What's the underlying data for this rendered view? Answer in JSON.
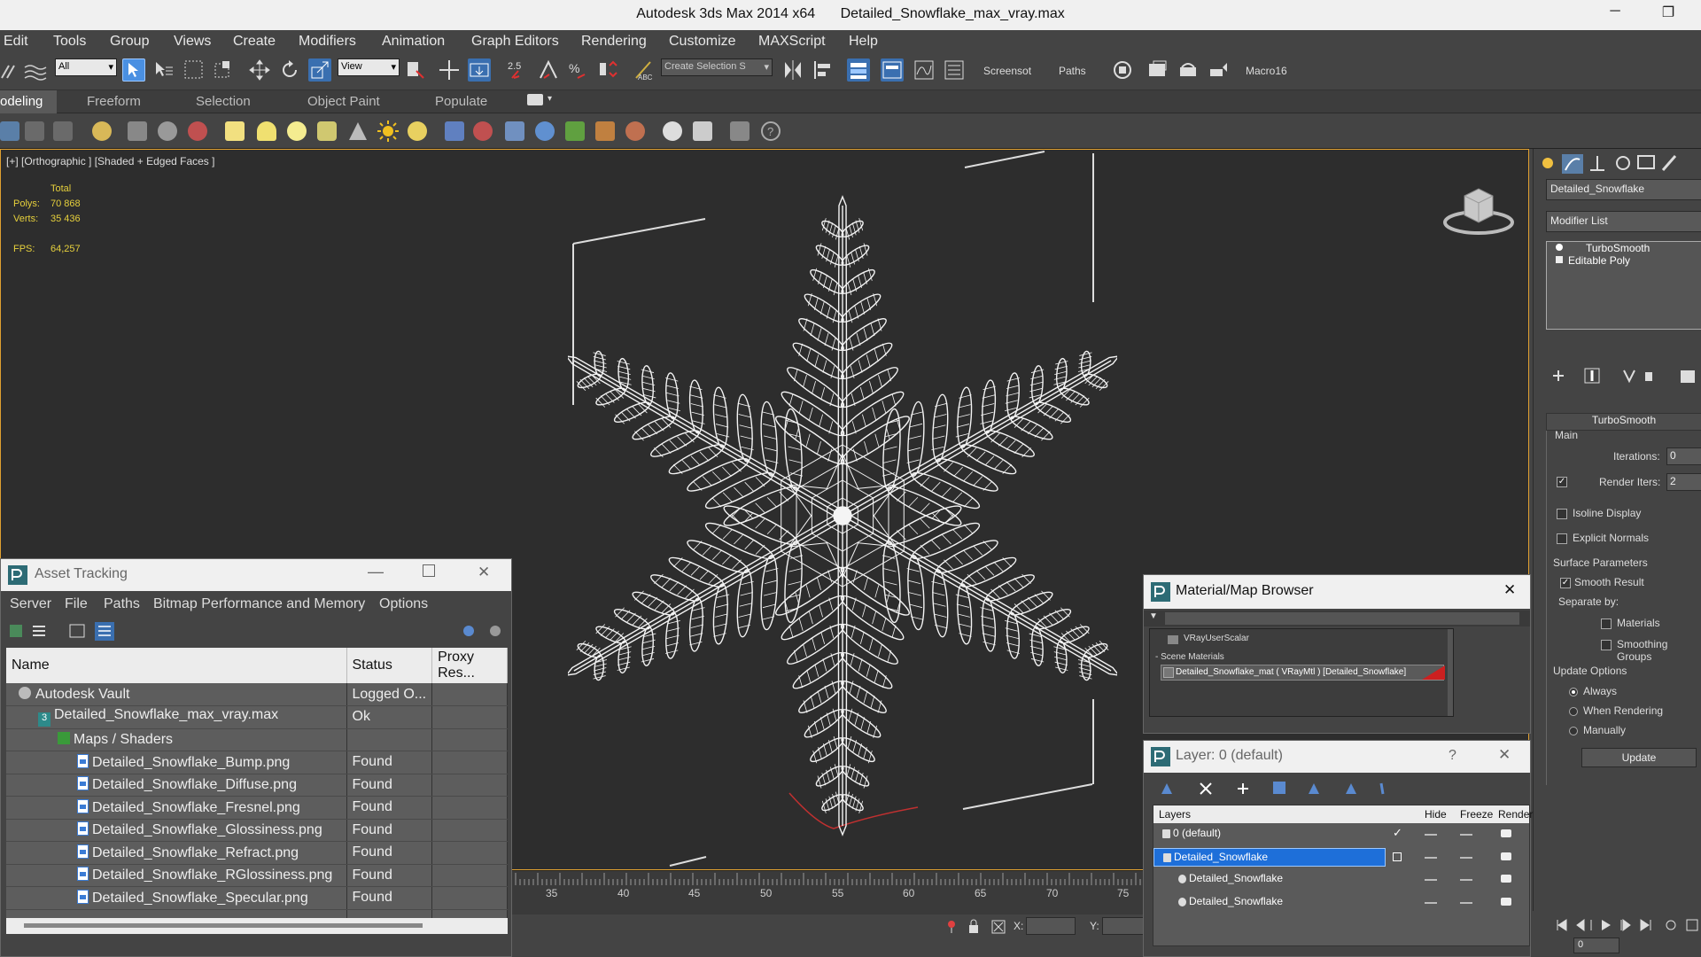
{
  "window": {
    "app_title": "Autodesk 3ds Max  2014 x64",
    "file_name": "Detailed_Snowflake_max_vray.max",
    "minimize": "─",
    "restore": "❐"
  },
  "menu": [
    "Edit",
    "Tools",
    "Group",
    "Views",
    "Create",
    "Modifiers",
    "Animation",
    "Graph Editors",
    "Rendering",
    "Customize",
    "MAXScript",
    "Help"
  ],
  "toolbar": {
    "filter_select": "All",
    "ref_coord_select": "View",
    "selection_set_placeholder": "Create Selection S",
    "snap_value": "2.5",
    "screenshot_label": "Screensot",
    "paths_label": "Paths",
    "macro_label": "Macro16"
  },
  "ribbon": {
    "tabs": [
      "odeling",
      "Freeform",
      "Selection",
      "Object Paint",
      "Populate"
    ]
  },
  "viewport": {
    "label": "[+] [Orthographic ] [Shaded + Edged Faces ]",
    "stats_total": "Total",
    "polys_label": "Polys:",
    "polys_value": "70 868",
    "verts_label": "Verts:",
    "verts_value": "35 436",
    "fps_label": "FPS:",
    "fps_value": "64,257"
  },
  "command_panel": {
    "object_name": "Detailed_Snowflake",
    "modifier_list": "Modifier List",
    "stack": [
      "TurboSmooth",
      "Editable Poly"
    ],
    "rollout_title": "TurboSmooth",
    "main_label": "Main",
    "iterations_label": "Iterations:",
    "iterations_value": "0",
    "render_iters_label": "Render Iters:",
    "render_iters_value": "2",
    "render_iters_checked": "✓",
    "isoline": "Isoline Display",
    "explicit_normals": "Explicit Normals",
    "surface_params": "Surface Parameters",
    "smooth_result": "Smooth Result",
    "smooth_result_checked": "✓",
    "separate_by": "Separate by:",
    "materials": "Materials",
    "smoothing_groups": "Smoothing Groups",
    "update_options": "Update Options",
    "always": "Always",
    "when_rendering": "When Rendering",
    "manually": "Manually",
    "update_button": "Update"
  },
  "timeline": {
    "ticks": [
      "35",
      "40",
      "45",
      "50",
      "55",
      "60",
      "65",
      "70",
      "75"
    ],
    "x_label": "X:",
    "y_label": "Y:",
    "frame_value": "0"
  },
  "asset_tracking": {
    "title": "Asset Tracking",
    "close": "✕",
    "menu": [
      "Server",
      "File",
      "Paths",
      "Bitmap Performance and Memory",
      "Options"
    ],
    "columns": [
      "Name",
      "Status",
      "Proxy Res..."
    ],
    "rows": [
      {
        "name": "Autodesk Vault",
        "status": "Logged O...",
        "indent": 0,
        "icon": "vault-icon"
      },
      {
        "name": "Detailed_Snowflake_max_vray.max",
        "status": "Ok",
        "indent": 1,
        "icon": "max-file-icon"
      },
      {
        "name": "Maps / Shaders",
        "status": "",
        "indent": 2,
        "icon": "maps-folder-icon"
      },
      {
        "name": "Detailed_Snowflake_Bump.png",
        "status": "Found",
        "indent": 3,
        "icon": "image-file-icon"
      },
      {
        "name": "Detailed_Snowflake_Diffuse.png",
        "status": "Found",
        "indent": 3,
        "icon": "image-file-icon"
      },
      {
        "name": "Detailed_Snowflake_Fresnel.png",
        "status": "Found",
        "indent": 3,
        "icon": "image-file-icon"
      },
      {
        "name": "Detailed_Snowflake_Glossiness.png",
        "status": "Found",
        "indent": 3,
        "icon": "image-file-icon"
      },
      {
        "name": "Detailed_Snowflake_Refract.png",
        "status": "Found",
        "indent": 3,
        "icon": "image-file-icon"
      },
      {
        "name": "Detailed_Snowflake_RGlossiness.png",
        "status": "Found",
        "indent": 3,
        "icon": "image-file-icon"
      },
      {
        "name": "Detailed_Snowflake_Specular.png",
        "status": "Found",
        "indent": 3,
        "icon": "image-file-icon"
      }
    ]
  },
  "material_browser": {
    "title": "Material/Map Browser",
    "close": "✕",
    "item_vray_scalar": "VRayUserScalar",
    "scene_materials": "- Scene Materials",
    "material_entry": "Detailed_Snowflake_mat  ( VRayMtl ) [Detailed_Snowflake]"
  },
  "layer_window": {
    "title": "Layer: 0 (default)",
    "help": "?",
    "close": "✕",
    "columns": [
      "Layers",
      "Hide",
      "Freeze",
      "Render"
    ],
    "rows": [
      "0 (default)",
      "Detailed_Snowflake",
      "Detailed_Snowflake",
      "Detailed_Snowflake"
    ]
  },
  "colors": {
    "accent_blue": "#1e6fd9",
    "viewport_border": "#e0a030",
    "stats_yellow": "#e6d03c",
    "material_red": "#cc2020"
  }
}
